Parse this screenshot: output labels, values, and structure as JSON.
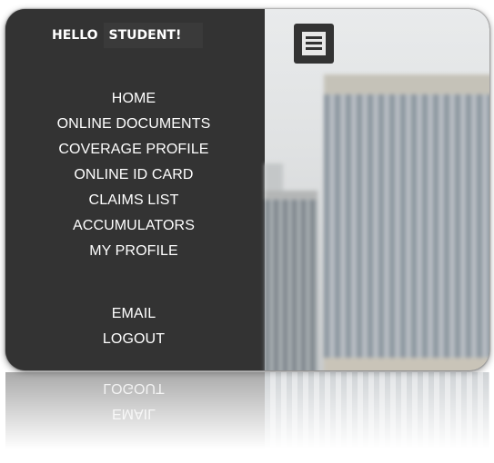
{
  "greeting": {
    "hello": "HELLO",
    "user": "STUDENT!"
  },
  "nav": {
    "items": [
      "HOME",
      "ONLINE DOCUMENTS",
      "COVERAGE PROFILE",
      "ONLINE ID CARD",
      "CLAIMS LIST",
      "ACCUMULATORS",
      "MY PROFILE"
    ],
    "secondary": [
      "EMAIL",
      "LOGOUT"
    ]
  },
  "icons": {
    "menu": "hamburger-menu-icon"
  },
  "colors": {
    "panel": "#333333",
    "text": "#ffffff"
  }
}
